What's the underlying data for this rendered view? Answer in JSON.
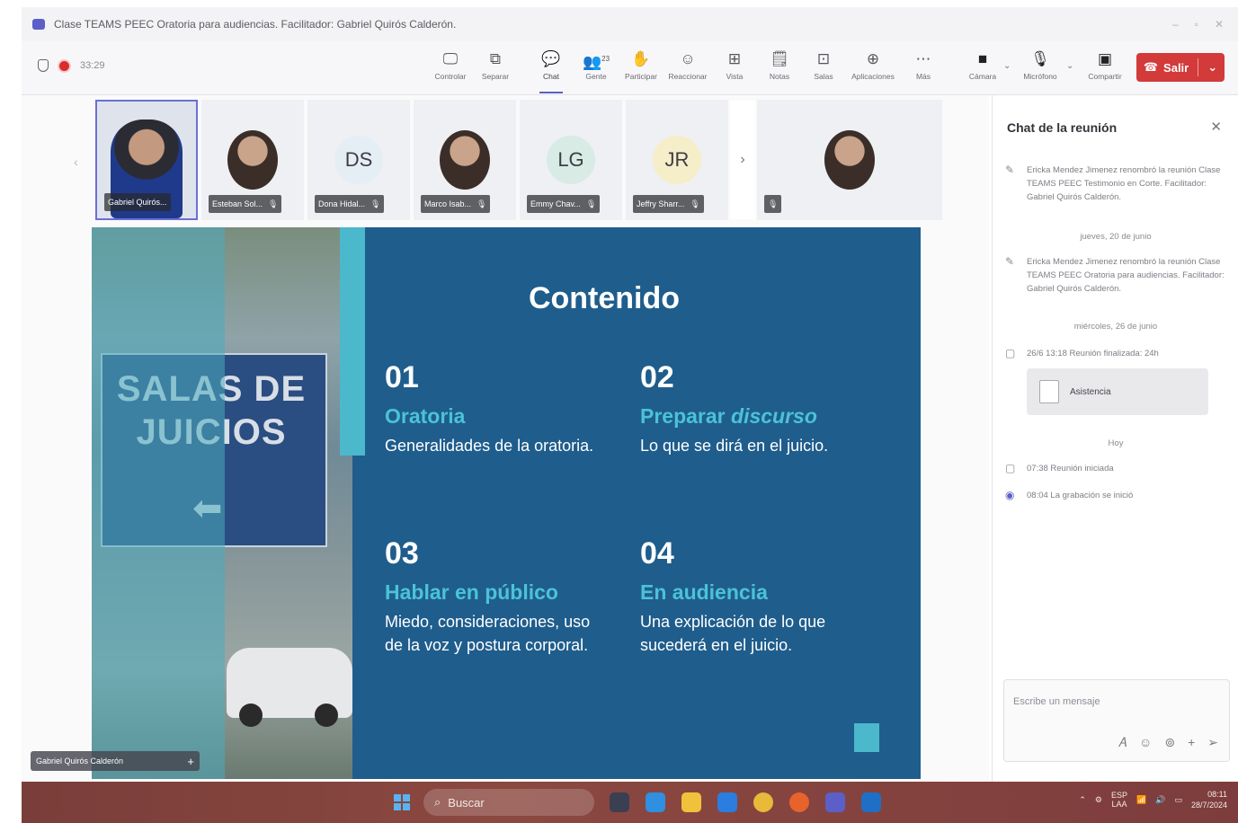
{
  "window": {
    "title": "Clase TEAMS PEEC Oratoria para audiencias. Facilitador: Gabriel Quirós Calderón.",
    "controls": [
      "–",
      "▫",
      "✕"
    ]
  },
  "meeting": {
    "elapsed": "33:29"
  },
  "toolbar": {
    "buttons": [
      {
        "label": "Controlar",
        "icon": "laptop-icon"
      },
      {
        "label": "Separar",
        "icon": "popout-icon"
      },
      {
        "label": "Chat",
        "icon": "chat-icon"
      },
      {
        "label": "Gente",
        "icon": "people-icon",
        "count": "23"
      },
      {
        "label": "Participar",
        "icon": "raise-hand-icon"
      },
      {
        "label": "Reaccionar",
        "icon": "smiley-icon"
      },
      {
        "label": "Vista",
        "icon": "grid-icon"
      },
      {
        "label": "Notas",
        "icon": "notes-icon"
      },
      {
        "label": "Salas",
        "icon": "rooms-icon"
      },
      {
        "label": "Aplicaciones",
        "icon": "apps-icon"
      },
      {
        "label": "Más",
        "icon": "more-icon"
      },
      {
        "label": "Cámara",
        "icon": "camera-off-icon"
      },
      {
        "label": "Micrófono",
        "icon": "mic-off-icon"
      },
      {
        "label": "Compartir",
        "icon": "share-icon"
      }
    ],
    "leave_label": "Salir"
  },
  "participants": [
    {
      "name": "Gabriel Quirós...",
      "initials": "",
      "type": "photo"
    },
    {
      "name": "Esteban Sol...",
      "initials": "",
      "type": "photo"
    },
    {
      "name": "Dona Hidal...",
      "initials": "DS",
      "type": "initials"
    },
    {
      "name": "Marco Isab...",
      "initials": "",
      "type": "photo"
    },
    {
      "name": "Emmy Chav...",
      "initials": "LG",
      "type": "initials"
    },
    {
      "name": "Jeffry Sharr...",
      "initials": "JR",
      "type": "initials"
    },
    {
      "name": "",
      "initials": "",
      "type": "photo"
    }
  ],
  "slide": {
    "title": "Contenido",
    "sign_text": "SALAS DE JUICIOS",
    "items": [
      {
        "num": "01",
        "head": "Oratoria",
        "head_italic": "",
        "desc": "Generalidades de la oratoria."
      },
      {
        "num": "02",
        "head": "Preparar",
        "head_italic": "discurso",
        "desc": "Lo que se dirá en el juicio."
      },
      {
        "num": "03",
        "head": "Hablar en público",
        "head_italic": "",
        "desc": "Miedo, consideraciones, uso de la voz y postura corporal."
      },
      {
        "num": "04",
        "head": "En audiencia",
        "head_italic": "",
        "desc": "Una explicación de lo que sucederá en el juicio."
      }
    ]
  },
  "speaker_label": "Gabriel Quirós Calderón",
  "chat": {
    "title": "Chat de la reunión",
    "messages": [
      {
        "icon": "pencil-icon",
        "text": "Ericka Mendez Jimenez renombró la reunión Clase TEAMS PEEC Testimonio en Corte. Facilitador: Gabriel Quirós Calderón."
      },
      {
        "date": "jueves, 20 de junio"
      },
      {
        "icon": "pencil-icon",
        "text": "Ericka Mendez Jimenez renombró la reunión Clase TEAMS PEEC Oratoria para audiencias. Facilitador: Gabriel Quirós Calderón."
      },
      {
        "date": "miércoles, 26 de junio"
      },
      {
        "icon": "meeting-icon",
        "text": "26/6 13:18 Reunión finalizada: 24h"
      },
      {
        "date": "Hoy"
      },
      {
        "icon": "meeting-icon",
        "text": "07:38 Reunión iniciada"
      },
      {
        "icon": "record-icon",
        "text": "08:04 La grabación se inició"
      }
    ],
    "attachment_label": "Asistencia",
    "composer_placeholder": "Escribe un mensaje"
  },
  "taskbar": {
    "search_label": "Buscar",
    "lang_top": "ESP",
    "lang_bottom": "LAA",
    "time": "08:11",
    "date": "28/7/2024"
  }
}
